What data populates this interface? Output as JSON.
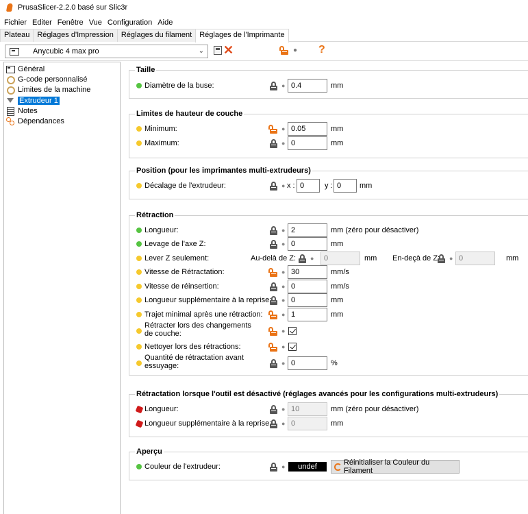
{
  "window": {
    "title": "PrusaSlicer-2.2.0 basé sur Slic3r"
  },
  "menu": [
    "Fichier",
    "Editer",
    "Fenêtre",
    "Vue",
    "Configuration",
    "Aide"
  ],
  "tabs": [
    "Plateau",
    "Réglages d'Impression",
    "Réglages du filament",
    "Réglages de l'Imprimante"
  ],
  "active_tab": "Réglages de l'Imprimante",
  "preset": {
    "value": "Anycubic 4 max pro",
    "help": "?"
  },
  "sidebar": {
    "items": [
      {
        "label": "Général",
        "icon": "window-icon"
      },
      {
        "label": "G-code personnalisé",
        "icon": "gear-icon"
      },
      {
        "label": "Limites de la machine",
        "icon": "gear-icon"
      },
      {
        "label": "Extrudeur 1",
        "icon": "funnel-icon",
        "selected": true
      },
      {
        "label": "Notes",
        "icon": "note-icon"
      },
      {
        "label": "Dépendances",
        "icon": "dependencies-icon"
      }
    ]
  },
  "groups": {
    "taille": {
      "title": "Taille",
      "diametre": {
        "label": "Diamètre de la buse:",
        "value": "0.4",
        "unit": "mm"
      }
    },
    "hauteur": {
      "title": "Limites de hauteur de couche",
      "minimum": {
        "label": "Minimum:",
        "value": "0.05",
        "unit": "mm"
      },
      "maximum": {
        "label": "Maximum:",
        "value": "0",
        "unit": "mm"
      }
    },
    "position": {
      "title": "Position (pour les imprimantes multi-extrudeurs)",
      "decalage": {
        "label": "Décalage de l'extrudeur:",
        "x_label": "x :",
        "x_value": "0",
        "y_label": "y :",
        "y_value": "0",
        "unit": "mm"
      }
    },
    "retraction": {
      "title": "Rétraction",
      "longueur": {
        "label": "Longueur:",
        "value": "2",
        "unit": "mm (zéro pour désactiver)"
      },
      "levage": {
        "label": "Levage de l'axe Z:",
        "value": "0",
        "unit": "mm"
      },
      "lever_z": {
        "label": "Lever Z seulement:",
        "above_label": "Au-delà de Z:",
        "above_value": "0",
        "above_unit": "mm",
        "below_label": "En-deçà de Z:",
        "below_value": "0",
        "below_unit": "mm"
      },
      "vitesse_retractation": {
        "label": "Vitesse de Rétractation:",
        "value": "30",
        "unit": "mm/s"
      },
      "vitesse_reinsertion": {
        "label": "Vitesse de réinsertion:",
        "value": "0",
        "unit": "mm/s"
      },
      "longueur_supp": {
        "label": "Longueur supplémentaire à la reprise:",
        "value": "0",
        "unit": "mm"
      },
      "trajet_minimal": {
        "label": "Trajet minimal après une rétraction:",
        "value": "1",
        "unit": "mm"
      },
      "retracter_couche": {
        "label": "Rétracter lors des changements de couche:",
        "checked": true
      },
      "nettoyer": {
        "label": "Nettoyer lors des rétractions:",
        "checked": true
      },
      "quantite_essuyage": {
        "label": "Quantité de rétractation avant essuyage:",
        "value": "0",
        "unit": "%"
      }
    },
    "retraction_desactive": {
      "title": "Rétractation lorsque l'outil est désactivé (réglages avancés pour les configurations multi-extrudeurs)",
      "longueur": {
        "label": "Longueur:",
        "value": "10",
        "unit": "mm (zéro pour désactiver)"
      },
      "longueur_supp": {
        "label": "Longueur supplémentaire à la reprise:",
        "value": "0",
        "unit": "mm"
      }
    },
    "apercu": {
      "title": "Aperçu",
      "couleur": {
        "label": "Couleur de l'extrudeur:",
        "swatch_text": "undef",
        "reset_label": "Réinitialiser la Couleur du Filament"
      }
    }
  },
  "colors": {
    "green": "#56c442",
    "yellow": "#f6c92d",
    "red": "#d01b1b",
    "orange": "#ea7417",
    "selection": "#0078d7"
  }
}
